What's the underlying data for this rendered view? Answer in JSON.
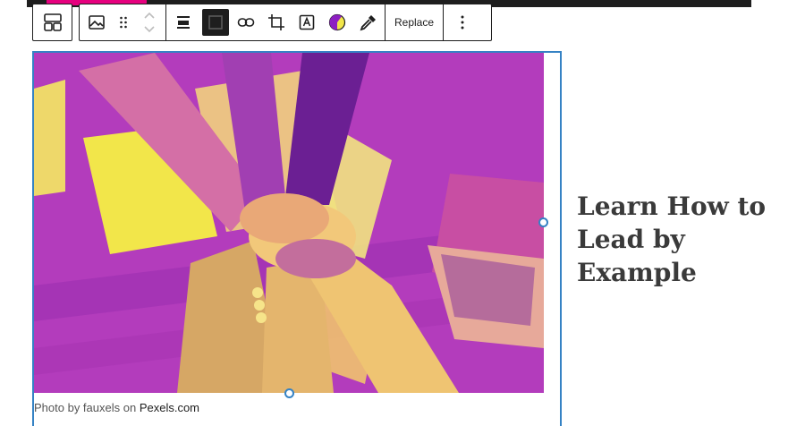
{
  "toolbar": {
    "block_type_icon": "layout-grid-icon",
    "image_icon": "image-icon",
    "drag_icon": "drag-handle-icon",
    "move_icon": "chevron-updown-icon",
    "align_icon": "align-center-icon",
    "full_width_icon": "square-icon",
    "link_icon": "link-icon",
    "crop_icon": "crop-icon",
    "text_overlay_icon": "text-box-icon",
    "duotone_icon": "duotone-icon",
    "eyedropper_icon": "eyedropper-icon",
    "replace_label": "Replace",
    "more_icon": "vertical-dots-icon"
  },
  "image": {
    "caption_prefix": "Photo by fauxels on ",
    "caption_link": "Pexels.com",
    "duotone_colors": [
      "#b63bbf",
      "#f2e64a"
    ]
  },
  "heading": {
    "text": "Learn How to Lead by Example"
  },
  "colors": {
    "accent": "#e6007e",
    "selection": "#3582c4",
    "toolbar_border": "#1e1e1e"
  }
}
